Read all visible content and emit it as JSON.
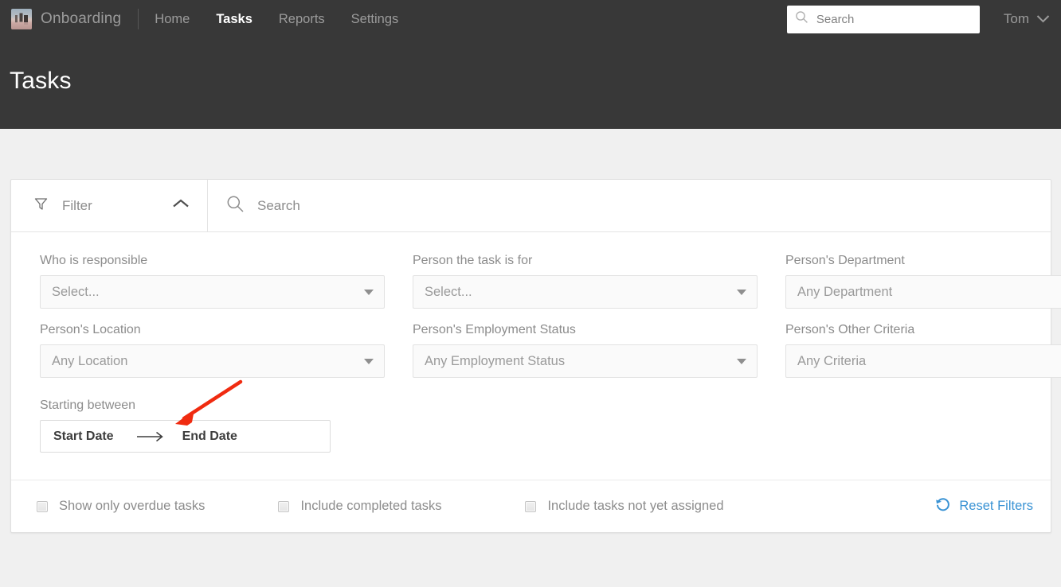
{
  "header": {
    "brand": {
      "name": "Onboarding",
      "logo_icon": "photo-logo-icon"
    },
    "nav": [
      {
        "label": "Home",
        "active": false
      },
      {
        "label": "Tasks",
        "active": true
      },
      {
        "label": "Reports",
        "active": false
      },
      {
        "label": "Settings",
        "active": false
      }
    ],
    "search": {
      "placeholder": "Search",
      "icon": "search-icon",
      "value": ""
    },
    "user": {
      "name": "Tom",
      "icon": "chevron-down-icon"
    },
    "page_title": "Tasks",
    "background_color": "#383838"
  },
  "filter_card": {
    "filter_toggle": {
      "label": "Filter",
      "icon": "funnel-icon",
      "chevron": "chevron-up-icon",
      "expanded": true
    },
    "search": {
      "placeholder": "Search",
      "icon": "search-icon",
      "value": ""
    },
    "fields": [
      {
        "label": "Who is responsible",
        "value": "Select...",
        "name": "who-is-responsible"
      },
      {
        "label": "Person the task is for",
        "value": "Select...",
        "name": "person-the-task-is-for"
      },
      {
        "label": "Person's Department",
        "value": "Any Department",
        "name": "persons-department"
      },
      {
        "label": "Person's Location",
        "value": "Any Location",
        "name": "persons-location"
      },
      {
        "label": "Person's Employment Status",
        "value": "Any Employment Status",
        "name": "persons-employment-status"
      },
      {
        "label": "Person's Other Criteria",
        "value": "Any Criteria",
        "name": "persons-other-criteria"
      }
    ],
    "date_range": {
      "label": "Starting between",
      "start_placeholder": "Start Date",
      "separator_icon": "right-arrow-icon",
      "end_placeholder": "End Date"
    },
    "checkboxes": [
      {
        "label": "Show only overdue tasks",
        "checked": false
      },
      {
        "label": "Include completed tasks",
        "checked": false
      },
      {
        "label": "Include tasks not yet assigned",
        "checked": false
      }
    ],
    "reset": {
      "label": "Reset Filters",
      "icon": "reset-circular-arrow-icon",
      "color": "#3a93d4"
    }
  },
  "annotation": {
    "type": "arrow",
    "color": "#f02b10",
    "points_at": "Starting between"
  }
}
